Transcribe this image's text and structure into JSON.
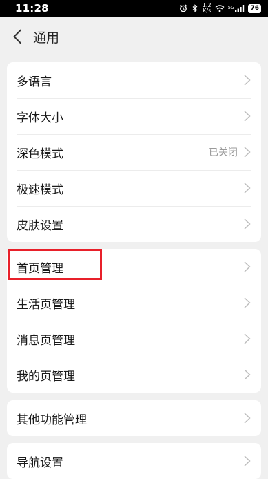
{
  "status_bar": {
    "time": "11:28",
    "speed_value": "1.2",
    "speed_unit": "K/s",
    "network": "5G",
    "battery": "76"
  },
  "header": {
    "title": "通用"
  },
  "groups": [
    {
      "items": [
        {
          "label": "多语言"
        },
        {
          "label": "字体大小"
        },
        {
          "label": "深色模式",
          "value": "已关闭"
        },
        {
          "label": "极速模式"
        },
        {
          "label": "皮肤设置"
        }
      ]
    },
    {
      "items": [
        {
          "label": "首页管理"
        },
        {
          "label": "生活页管理"
        },
        {
          "label": "消息页管理"
        },
        {
          "label": "我的页管理"
        }
      ]
    },
    {
      "items": [
        {
          "label": "其他功能管理"
        }
      ]
    },
    {
      "items": [
        {
          "label": "导航设置"
        }
      ]
    }
  ],
  "colors": {
    "highlight": "#e8202a",
    "background": "#f0f0f0"
  },
  "icons": [
    "back-arrow-icon",
    "chevron-right-icon",
    "alarm-icon",
    "bluetooth-icon",
    "wifi-icon",
    "signal-icon",
    "battery-icon"
  ]
}
